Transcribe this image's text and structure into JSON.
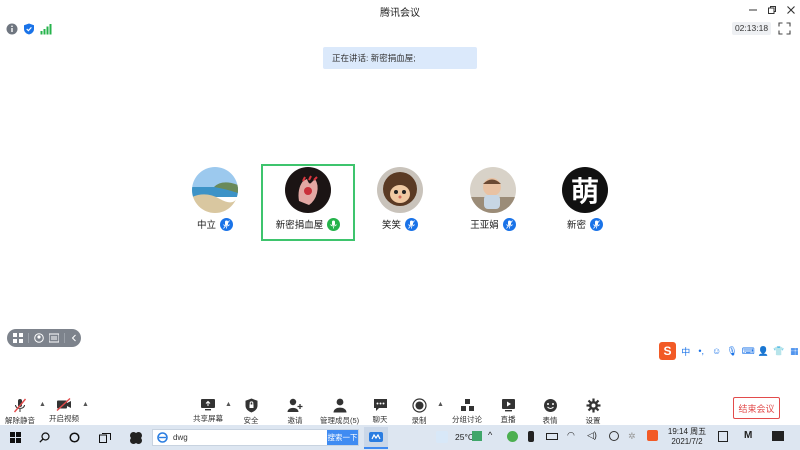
{
  "window": {
    "title": "腾讯会议",
    "controls": [
      "minimize-icon",
      "restore-icon",
      "close-icon"
    ]
  },
  "status": {
    "icons": [
      "info-icon",
      "shield-icon",
      "signal-icon"
    ],
    "timer": "02:13:18"
  },
  "speaking_banner": "正在讲话: 新密捐血屋;",
  "participants": [
    {
      "name": "中立",
      "avatar": "beach-avatar",
      "active": false
    },
    {
      "name": "新密捐血屋",
      "avatar": "hand-avatar",
      "active": true
    },
    {
      "name": "笑笑",
      "avatar": "monchhichi-avatar",
      "active": false
    },
    {
      "name": "王亚娟",
      "avatar": "baby-avatar",
      "active": false
    },
    {
      "name": "新密",
      "avatar": "meng-char-avatar",
      "avatar_text": "萌",
      "active": false
    }
  ],
  "toolbar": {
    "unmute": "解除静音",
    "start_video": "开启视频",
    "share_screen": "共享屏幕",
    "security": "安全",
    "invite": "邀请",
    "manage_members": "管理成员(5)",
    "chat": "聊天",
    "record": "录制",
    "breakout": "分组讨论",
    "live": "直播",
    "reactions": "表情",
    "settings": "设置",
    "end_meeting": "结束会议"
  },
  "ime": {
    "logo": "S",
    "lang": "中"
  },
  "taskbar": {
    "search_text": "dwg",
    "search_button": "搜索一下",
    "weather": "25°C",
    "time": "19:14 周五",
    "date": "2021/7/2"
  },
  "colors": {
    "active_border": "#3ec46d",
    "mic_badge": "#1a73e8",
    "end_button": "#e24b4b",
    "banner_bg": "#dbe9fb"
  }
}
